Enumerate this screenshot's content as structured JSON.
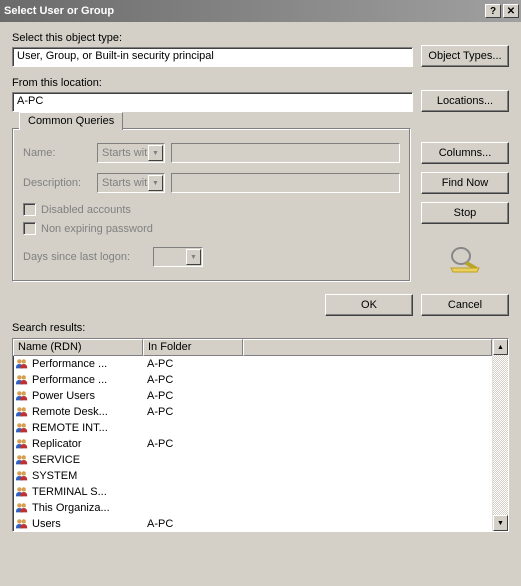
{
  "title": "Select User or Group",
  "objectType": {
    "label": "Select this object type:",
    "value": "User, Group, or Built-in security principal",
    "button": "Object Types..."
  },
  "location": {
    "label": "From this location:",
    "value": "A-PC",
    "button": "Locations..."
  },
  "queries": {
    "tab": "Common Queries",
    "nameLabel": "Name:",
    "nameMode": "Starts with",
    "descLabel": "Description:",
    "descMode": "Starts with",
    "disabled": "Disabled accounts",
    "nonExpiring": "Non expiring password",
    "daysLabel": "Days since last logon:"
  },
  "sideButtons": {
    "columns": "Columns...",
    "findNow": "Find Now",
    "stop": "Stop"
  },
  "bottom": {
    "ok": "OK",
    "cancel": "Cancel"
  },
  "results": {
    "label": "Search results:",
    "columns": {
      "name": "Name (RDN)",
      "folder": "In Folder"
    },
    "rows": [
      {
        "name": "Performance ...",
        "folder": "A-PC"
      },
      {
        "name": "Performance ...",
        "folder": "A-PC"
      },
      {
        "name": "Power Users",
        "folder": "A-PC"
      },
      {
        "name": "Remote Desk...",
        "folder": "A-PC"
      },
      {
        "name": "REMOTE INT...",
        "folder": ""
      },
      {
        "name": "Replicator",
        "folder": "A-PC"
      },
      {
        "name": "SERVICE",
        "folder": ""
      },
      {
        "name": "SYSTEM",
        "folder": ""
      },
      {
        "name": "TERMINAL S...",
        "folder": ""
      },
      {
        "name": "This Organiza...",
        "folder": ""
      },
      {
        "name": "Users",
        "folder": "A-PC"
      }
    ]
  }
}
